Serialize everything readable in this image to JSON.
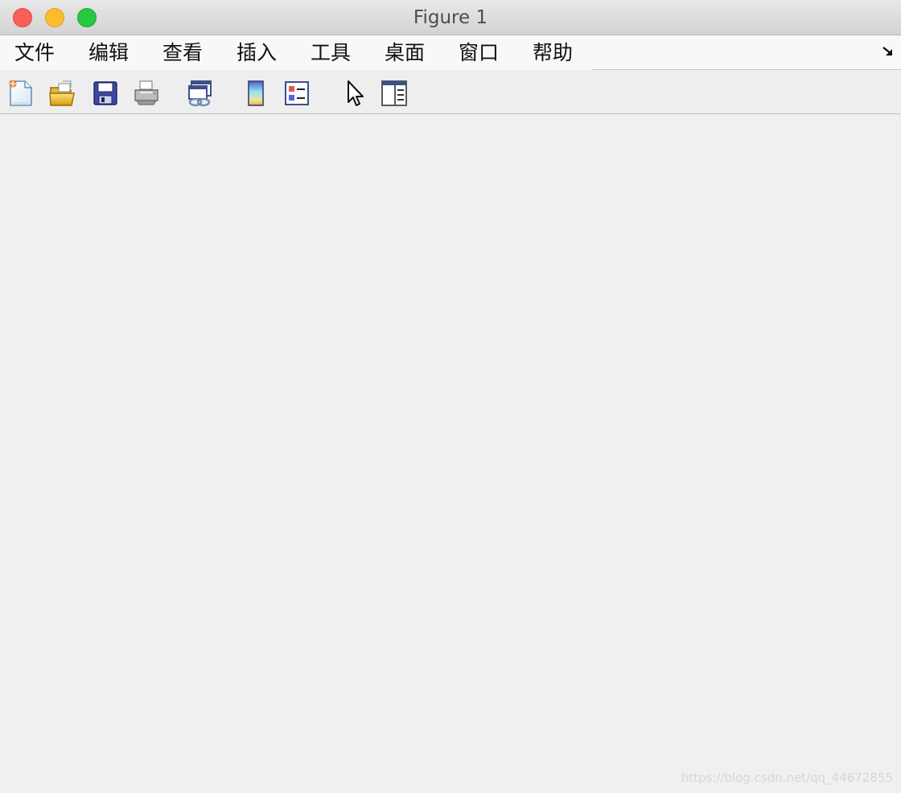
{
  "window": {
    "title": "Figure 1"
  },
  "traffic_lights": {
    "close": "#fc5f57",
    "minimize": "#fdbc2e",
    "zoom": "#28c840"
  },
  "menubar": {
    "items": [
      {
        "label": "文件"
      },
      {
        "label": "编辑"
      },
      {
        "label": "查看"
      },
      {
        "label": "插入"
      },
      {
        "label": "工具"
      },
      {
        "label": "桌面"
      },
      {
        "label": "窗口"
      },
      {
        "label": "帮助"
      }
    ],
    "dock_icon": "dock-arrow-icon"
  },
  "toolbar": {
    "tools": [
      {
        "icon": "new-figure-icon"
      },
      {
        "icon": "open-file-icon"
      },
      {
        "icon": "save-icon"
      },
      {
        "icon": "print-icon"
      },
      {
        "icon": "link-plot-icon"
      },
      {
        "icon": "colorbar-icon"
      },
      {
        "icon": "legend-icon"
      },
      {
        "icon": "edit-plot-pointer-icon"
      },
      {
        "icon": "property-inspector-icon"
      }
    ]
  },
  "watermark": "https://blog.csdn.net/qq_44672855"
}
